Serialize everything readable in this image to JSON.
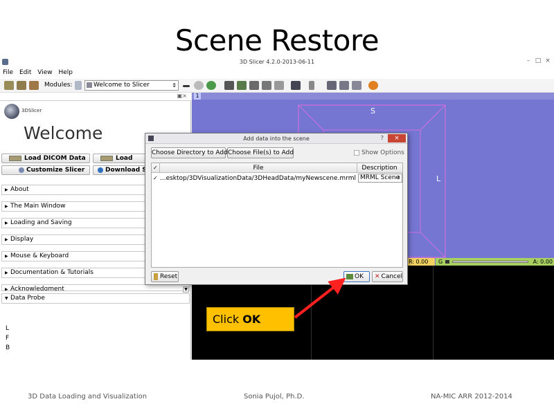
{
  "slide": {
    "title": "Scene Restore",
    "footer_left": "3D Data Loading and Visualization",
    "footer_center": "Sonia Pujol, Ph.D.",
    "footer_right": "NA-MIC ARR 2012-2014"
  },
  "window": {
    "title": "3D Slicer 4.2.0-2013-06-11",
    "minimize": "–",
    "maximize": "□",
    "close": "×"
  },
  "menu": [
    "File",
    "Edit",
    "View",
    "Help"
  ],
  "toolbar": {
    "modules_label": "Modules:",
    "module_selected": "Welcome to Slicer"
  },
  "left_panel": {
    "logo_text": "3DSlicer",
    "welcome": "Welcome",
    "load_dicom": "Load DICOM Data",
    "load_data": "Load",
    "customize": "Customize Slicer",
    "download": "Download Sa",
    "sections": [
      "About",
      "The Main Window",
      "Loading and Saving",
      "Display",
      "Mouse & Keyboard",
      "Documentation & Tutorials",
      "Acknowledgment"
    ],
    "data_probe": "Data Probe",
    "probe_letters": [
      "L",
      "F",
      "B"
    ]
  },
  "view3d": {
    "number": "1",
    "label_s": "S",
    "label_l": "L"
  },
  "slice_bars": {
    "red": "R: 0.00",
    "green_label": "G",
    "green_value": "A: 0.00"
  },
  "dialog": {
    "title": "Add data into the scene",
    "help": "?",
    "close": "×",
    "choose_dir": "Choose Directory to Add",
    "choose_files": "Choose File(s) to Add",
    "show_options": "Show Options",
    "col_check": "✓",
    "col_file": "File",
    "col_description": "Description",
    "rows": [
      {
        "checked": "✓",
        "file": "...esktop/3DVisualizationData/3DHeadData/myNewscene.mrml",
        "description": "MRML Scene"
      }
    ],
    "reset": "Reset",
    "ok": "OK",
    "cancel": "Cancel"
  },
  "callout": {
    "prefix": "Click ",
    "bold": "OK"
  },
  "colors": {
    "view3d_bg": "#7575d2",
    "bbox": "#d070e0",
    "callout_bg": "#ffc000",
    "arrow": "#ff2020",
    "red_slice": "#f0d060",
    "green_slice": "#a8d060"
  }
}
